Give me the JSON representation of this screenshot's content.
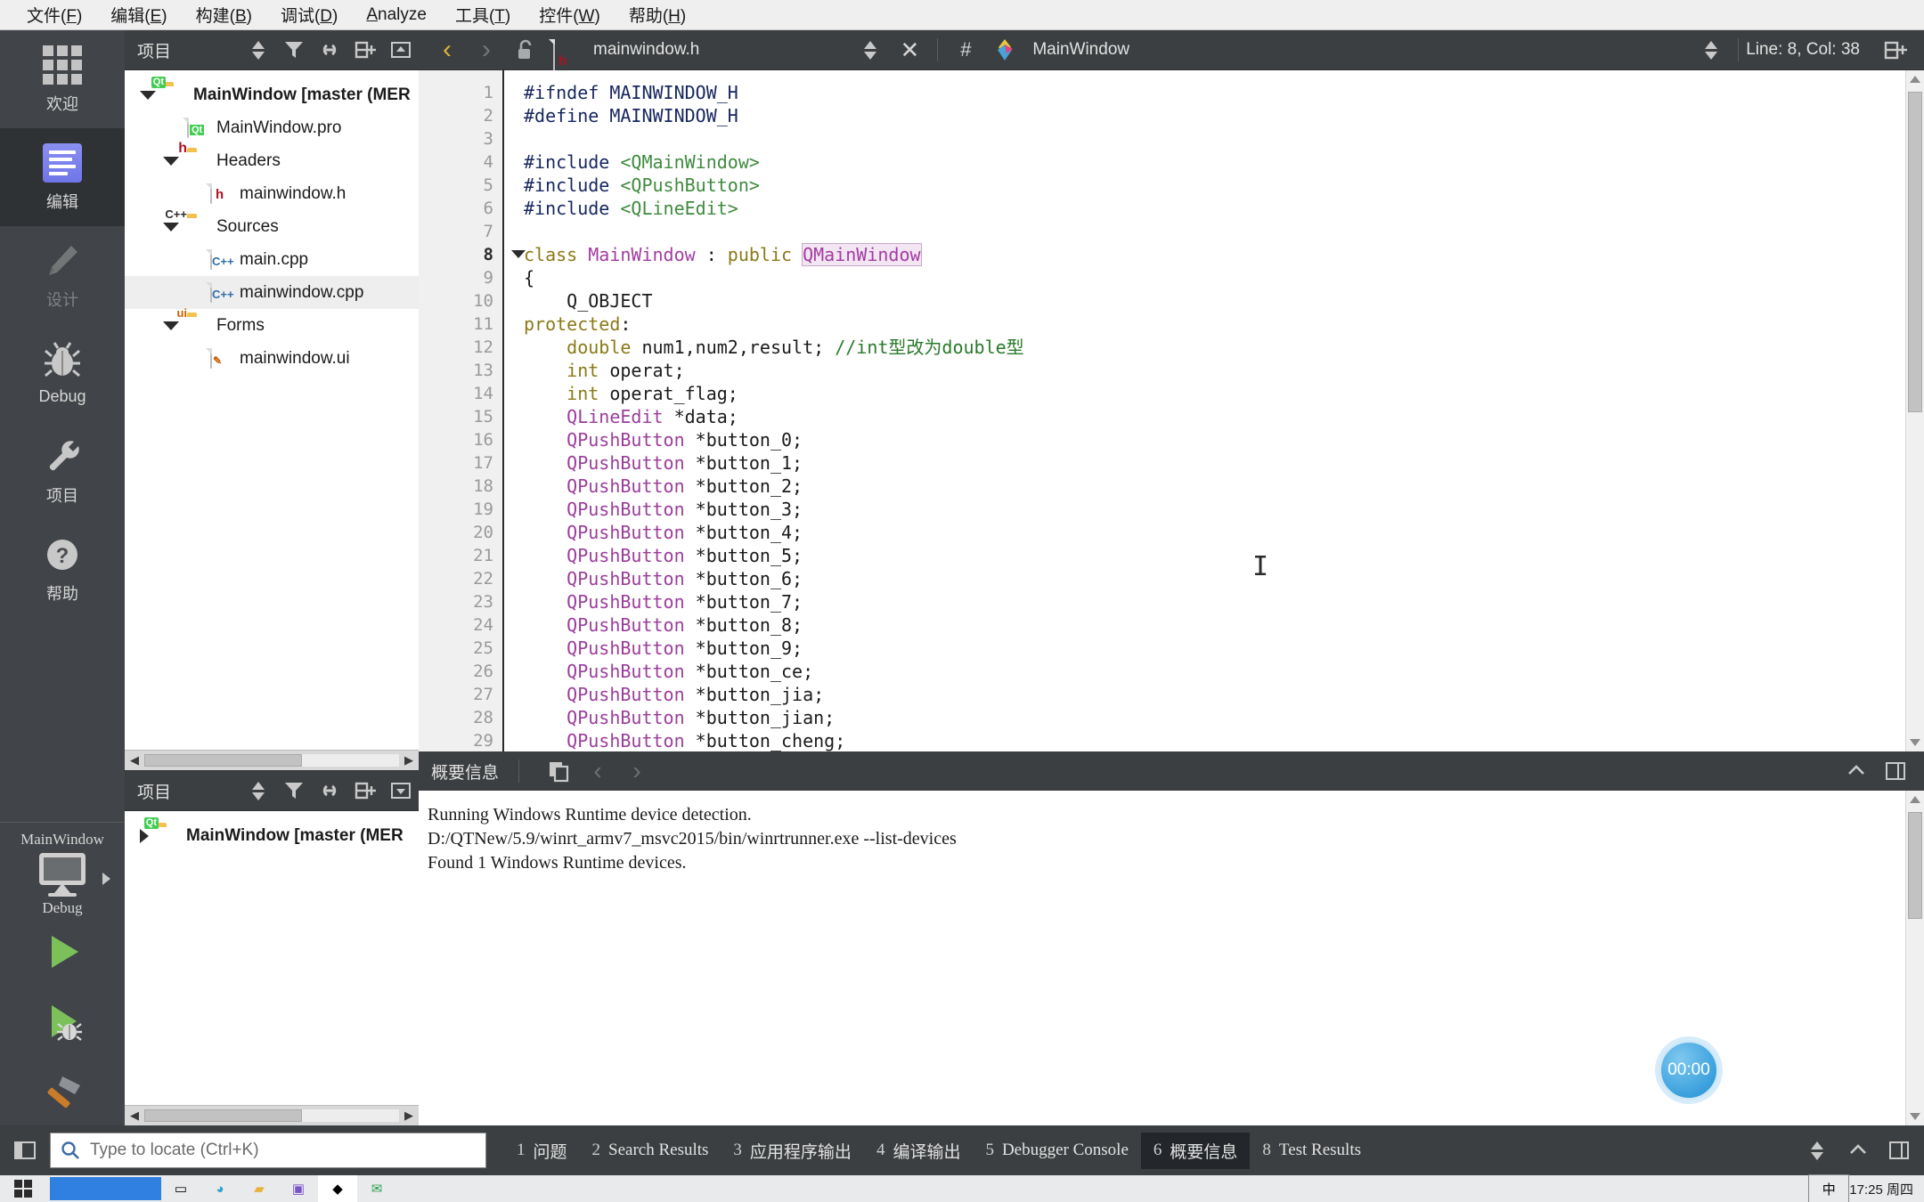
{
  "menubar": {
    "items": [
      {
        "label_pre": "文件(",
        "accel": "F",
        "label_post": ")"
      },
      {
        "label_pre": "编辑(",
        "accel": "E",
        "label_post": ")"
      },
      {
        "label_pre": "构建(",
        "accel": "B",
        "label_post": ")"
      },
      {
        "label_pre": "调试(",
        "accel": "D",
        "label_post": ")"
      },
      {
        "label_pre": "",
        "accel": "A",
        "label_post": "nalyze"
      },
      {
        "label_pre": "工具(",
        "accel": "T",
        "label_post": ")"
      },
      {
        "label_pre": "控件(",
        "accel": "W",
        "label_post": ")"
      },
      {
        "label_pre": "帮助(",
        "accel": "H",
        "label_post": ")"
      }
    ]
  },
  "modebar": {
    "modes": [
      {
        "label": "欢迎",
        "icon": "grid-icon",
        "state": "normal"
      },
      {
        "label": "编辑",
        "icon": "edit-lines-icon",
        "state": "active"
      },
      {
        "label": "设计",
        "icon": "pencil-icon",
        "state": "disabled"
      },
      {
        "label": "Debug",
        "icon": "bug-icon",
        "state": "normal"
      },
      {
        "label": "项目",
        "icon": "wrench-icon",
        "state": "normal"
      },
      {
        "label": "帮助",
        "icon": "question-circle-icon",
        "state": "normal"
      }
    ],
    "kit": {
      "project_name": "MainWindow",
      "icon": "monitor-icon",
      "build_config": "Debug"
    },
    "actions": [
      {
        "name": "run-button",
        "icon": "green-play-icon"
      },
      {
        "name": "debug-run-button",
        "icon": "green-play-bug-icon"
      },
      {
        "name": "build-button",
        "icon": "hammer-icon"
      }
    ]
  },
  "project_dock": {
    "title": "项目",
    "toolbar_icons": [
      "sync-updown-icon",
      "filter-icon",
      "link-icon",
      "split-add-icon",
      "collapse-icon"
    ],
    "tree": [
      {
        "depth": 0,
        "label": "MainWindow [master (MER",
        "icon": "folder-qt-icon",
        "expanded": true,
        "bold": true,
        "selected": false
      },
      {
        "depth": 1,
        "label": "MainWindow.pro",
        "icon": "file-qt-icon",
        "expanded": null,
        "bold": false,
        "selected": false
      },
      {
        "depth": 1,
        "label": "Headers",
        "icon": "folder-h-icon",
        "expanded": true,
        "bold": false,
        "selected": false
      },
      {
        "depth": 2,
        "label": "mainwindow.h",
        "icon": "file-h-icon",
        "expanded": null,
        "bold": false,
        "selected": false
      },
      {
        "depth": 1,
        "label": "Sources",
        "icon": "folder-cpp-icon",
        "expanded": true,
        "bold": false,
        "selected": false
      },
      {
        "depth": 2,
        "label": "main.cpp",
        "icon": "file-cpp-icon",
        "expanded": null,
        "bold": false,
        "selected": false
      },
      {
        "depth": 2,
        "label": "mainwindow.cpp",
        "icon": "file-cpp-icon",
        "expanded": null,
        "bold": false,
        "selected": true
      },
      {
        "depth": 1,
        "label": "Forms",
        "icon": "folder-ui-icon",
        "expanded": true,
        "bold": false,
        "selected": false
      },
      {
        "depth": 2,
        "label": "mainwindow.ui",
        "icon": "file-ui-icon",
        "expanded": null,
        "bold": false,
        "selected": false
      }
    ]
  },
  "secondary_dock": {
    "title": "项目",
    "tree": [
      {
        "depth": 0,
        "label": "MainWindow [master (MER",
        "icon": "folder-qt-icon",
        "expanded": false,
        "bold": true,
        "selected": false
      }
    ]
  },
  "editor_toolbar": {
    "back_icon": "chevron-left-icon",
    "forward_icon": "chevron-right-icon",
    "lock_icon": "unlock-icon",
    "file_icon": "file-h-icon",
    "filename": "mainwindow.h",
    "dropdown_icon": "updown-arrows-icon",
    "close_icon": "close-x-icon",
    "hash_label": "#",
    "symbol_icon": "qt-symbol-icon",
    "symbol_name": "MainWindow",
    "line_col": "Line: 8, Col: 38",
    "split_icon": "split-editor-icon"
  },
  "code": {
    "first_line": 1,
    "current_line": 8,
    "lines": [
      {
        "n": 1,
        "tokens": [
          {
            "t": "#ifndef MAINWINDOW_H",
            "c": "k-pre"
          }
        ]
      },
      {
        "n": 2,
        "tokens": [
          {
            "t": "#define MAINWINDOW_H",
            "c": "k-pre"
          }
        ]
      },
      {
        "n": 3,
        "tokens": []
      },
      {
        "n": 4,
        "tokens": [
          {
            "t": "#include ",
            "c": "k-pre"
          },
          {
            "t": "<QMainWindow>",
            "c": "k-inc"
          }
        ]
      },
      {
        "n": 5,
        "tokens": [
          {
            "t": "#include ",
            "c": "k-pre"
          },
          {
            "t": "<QPushButton>",
            "c": "k-inc"
          }
        ]
      },
      {
        "n": 6,
        "tokens": [
          {
            "t": "#include ",
            "c": "k-pre"
          },
          {
            "t": "<QLineEdit>",
            "c": "k-inc"
          }
        ]
      },
      {
        "n": 7,
        "tokens": []
      },
      {
        "n": 8,
        "fold": true,
        "tokens": [
          {
            "t": "class ",
            "c": "k-kw"
          },
          {
            "t": "MainWindow",
            "c": "k-cls"
          },
          {
            "t": " : ",
            "c": ""
          },
          {
            "t": "public ",
            "c": "k-kw"
          },
          {
            "t": "QMainWindow",
            "c": "k-cls k-hl"
          }
        ]
      },
      {
        "n": 9,
        "tokens": [
          {
            "t": "{",
            "c": ""
          }
        ]
      },
      {
        "n": 10,
        "tokens": [
          {
            "t": "    Q_OBJECT",
            "c": ""
          }
        ]
      },
      {
        "n": 11,
        "tokens": [
          {
            "t": "protected",
            "c": "k-lbl"
          },
          {
            "t": ":",
            "c": ""
          }
        ]
      },
      {
        "n": 12,
        "tokens": [
          {
            "t": "    ",
            "c": ""
          },
          {
            "t": "double",
            "c": "k-kw"
          },
          {
            "t": " num1,num2,result; ",
            "c": ""
          },
          {
            "t": "//int型改为double型",
            "c": "k-cmt"
          }
        ]
      },
      {
        "n": 13,
        "tokens": [
          {
            "t": "    ",
            "c": ""
          },
          {
            "t": "int",
            "c": "k-kw"
          },
          {
            "t": " operat;",
            "c": ""
          }
        ]
      },
      {
        "n": 14,
        "tokens": [
          {
            "t": "    ",
            "c": ""
          },
          {
            "t": "int",
            "c": "k-kw"
          },
          {
            "t": " operat_flag;",
            "c": ""
          }
        ]
      },
      {
        "n": 15,
        "tokens": [
          {
            "t": "    ",
            "c": ""
          },
          {
            "t": "QLineEdit",
            "c": "k-type"
          },
          {
            "t": " *data;",
            "c": ""
          }
        ]
      },
      {
        "n": 16,
        "tokens": [
          {
            "t": "    ",
            "c": ""
          },
          {
            "t": "QPushButton",
            "c": "k-type"
          },
          {
            "t": " *button_0;",
            "c": ""
          }
        ]
      },
      {
        "n": 17,
        "tokens": [
          {
            "t": "    ",
            "c": ""
          },
          {
            "t": "QPushButton",
            "c": "k-type"
          },
          {
            "t": " *button_1;",
            "c": ""
          }
        ]
      },
      {
        "n": 18,
        "tokens": [
          {
            "t": "    ",
            "c": ""
          },
          {
            "t": "QPushButton",
            "c": "k-type"
          },
          {
            "t": " *button_2;",
            "c": ""
          }
        ]
      },
      {
        "n": 19,
        "tokens": [
          {
            "t": "    ",
            "c": ""
          },
          {
            "t": "QPushButton",
            "c": "k-type"
          },
          {
            "t": " *button_3;",
            "c": ""
          }
        ]
      },
      {
        "n": 20,
        "tokens": [
          {
            "t": "    ",
            "c": ""
          },
          {
            "t": "QPushButton",
            "c": "k-type"
          },
          {
            "t": " *button_4;",
            "c": ""
          }
        ]
      },
      {
        "n": 21,
        "tokens": [
          {
            "t": "    ",
            "c": ""
          },
          {
            "t": "QPushButton",
            "c": "k-type"
          },
          {
            "t": " *button_5;",
            "c": ""
          }
        ]
      },
      {
        "n": 22,
        "tokens": [
          {
            "t": "    ",
            "c": ""
          },
          {
            "t": "QPushButton",
            "c": "k-type"
          },
          {
            "t": " *button_6;",
            "c": ""
          }
        ]
      },
      {
        "n": 23,
        "tokens": [
          {
            "t": "    ",
            "c": ""
          },
          {
            "t": "QPushButton",
            "c": "k-type"
          },
          {
            "t": " *button_7;",
            "c": ""
          }
        ]
      },
      {
        "n": 24,
        "tokens": [
          {
            "t": "    ",
            "c": ""
          },
          {
            "t": "QPushButton",
            "c": "k-type"
          },
          {
            "t": " *button_8;",
            "c": ""
          }
        ]
      },
      {
        "n": 25,
        "tokens": [
          {
            "t": "    ",
            "c": ""
          },
          {
            "t": "QPushButton",
            "c": "k-type"
          },
          {
            "t": " *button_9;",
            "c": ""
          }
        ]
      },
      {
        "n": 26,
        "tokens": [
          {
            "t": "    ",
            "c": ""
          },
          {
            "t": "QPushButton",
            "c": "k-type"
          },
          {
            "t": " *button_ce;",
            "c": ""
          }
        ]
      },
      {
        "n": 27,
        "tokens": [
          {
            "t": "    ",
            "c": ""
          },
          {
            "t": "QPushButton",
            "c": "k-type"
          },
          {
            "t": " *button_jia;",
            "c": ""
          }
        ]
      },
      {
        "n": 28,
        "tokens": [
          {
            "t": "    ",
            "c": ""
          },
          {
            "t": "QPushButton",
            "c": "k-type"
          },
          {
            "t": " *button_jian;",
            "c": ""
          }
        ]
      },
      {
        "n": 29,
        "tokens": [
          {
            "t": "    ",
            "c": ""
          },
          {
            "t": "QPushButton",
            "c": "k-type"
          },
          {
            "t": " *button_cheng;",
            "c": ""
          }
        ]
      }
    ]
  },
  "output_pane": {
    "title": "概要信息",
    "toolbar_icons": [
      "copy-icon",
      "prev-arrow-icon",
      "next-arrow-icon"
    ],
    "right_icons": [
      "chevron-up-icon",
      "maximize-icon"
    ],
    "lines": [
      "Running Windows Runtime device detection.",
      "D:/QTNew/5.9/winrt_armv7_msvc2015/bin/winrtrunner.exe --list-devices",
      "Found 1 Windows Runtime devices."
    ],
    "timer_badge": "00:00"
  },
  "statusbar": {
    "sidebar_toggle_icon": "sidebar-icon",
    "search_icon": "search-icon",
    "locate_placeholder": "Type to locate (Ctrl+K)",
    "tabs": [
      {
        "num": "1",
        "label": "问题",
        "active": false
      },
      {
        "num": "2",
        "label": "Search Results",
        "active": false
      },
      {
        "num": "3",
        "label": "应用程序输出",
        "active": false
      },
      {
        "num": "4",
        "label": "编译输出",
        "active": false
      },
      {
        "num": "5",
        "label": "Debugger Console",
        "active": false
      },
      {
        "num": "6",
        "label": "概要信息",
        "active": true
      },
      {
        "num": "8",
        "label": "Test Results",
        "active": false
      }
    ],
    "right_icons": [
      "updown-arrows-icon",
      "chevron-up-icon",
      "maximize-icon"
    ]
  },
  "taskbar": {
    "start_icon": "windows-start-icon",
    "icons": [
      "search-box",
      "task-view-icon",
      "edge-icon",
      "explorer-icon",
      "store-icon",
      "qt-icon",
      "mail-icon",
      "ime-icon"
    ],
    "clock": "17:25 周四"
  },
  "colors": {
    "chrome": "#3c3f41",
    "menubar_bg": "#efefef",
    "accent_blue": "#6f75e8",
    "run_green": "#7cc05a",
    "qt_green": "#41cd52",
    "editor_bg": "#ffffff",
    "gutter_bg": "#f0f0f0"
  }
}
